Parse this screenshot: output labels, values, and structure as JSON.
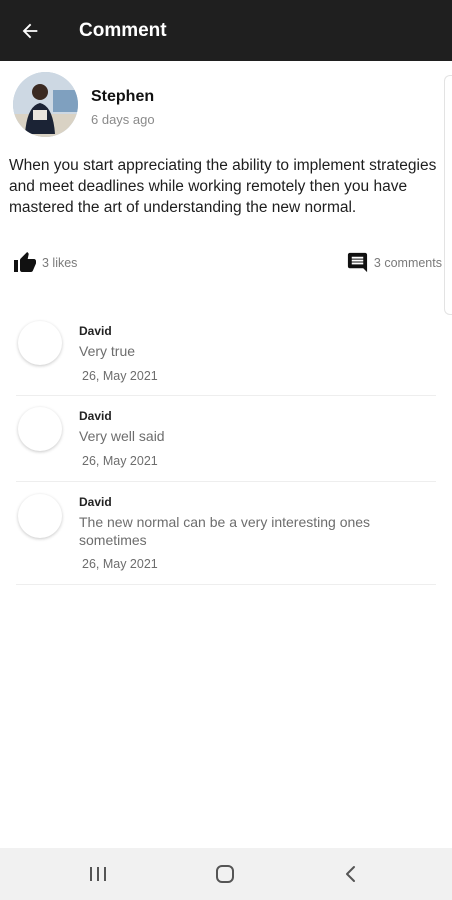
{
  "appbar": {
    "title": "Comment",
    "background": "#1f1f1f"
  },
  "post": {
    "author": "Stephen",
    "time": "6 days ago",
    "body": "When you start appreciating the ability to implement strategies and meet deadlines while working remotely then you have mastered the art of understanding the new normal.",
    "likes": "3 likes",
    "comments": "3 comments"
  },
  "comments": [
    {
      "name": "David",
      "text": "Very true",
      "date": "26, May 2021"
    },
    {
      "name": "David",
      "text": "Very well said",
      "date": "26, May 2021"
    },
    {
      "name": "David",
      "text": "The new normal can be a very interesting ones sometimes",
      "date": "26, May 2021"
    }
  ],
  "icons": {
    "back": "arrow-left-icon",
    "like": "thumbs-up-icon",
    "comment": "comment-bubble-icon",
    "recents": "recent-apps-icon",
    "home": "home-icon",
    "nav_back": "chevron-left-icon"
  }
}
